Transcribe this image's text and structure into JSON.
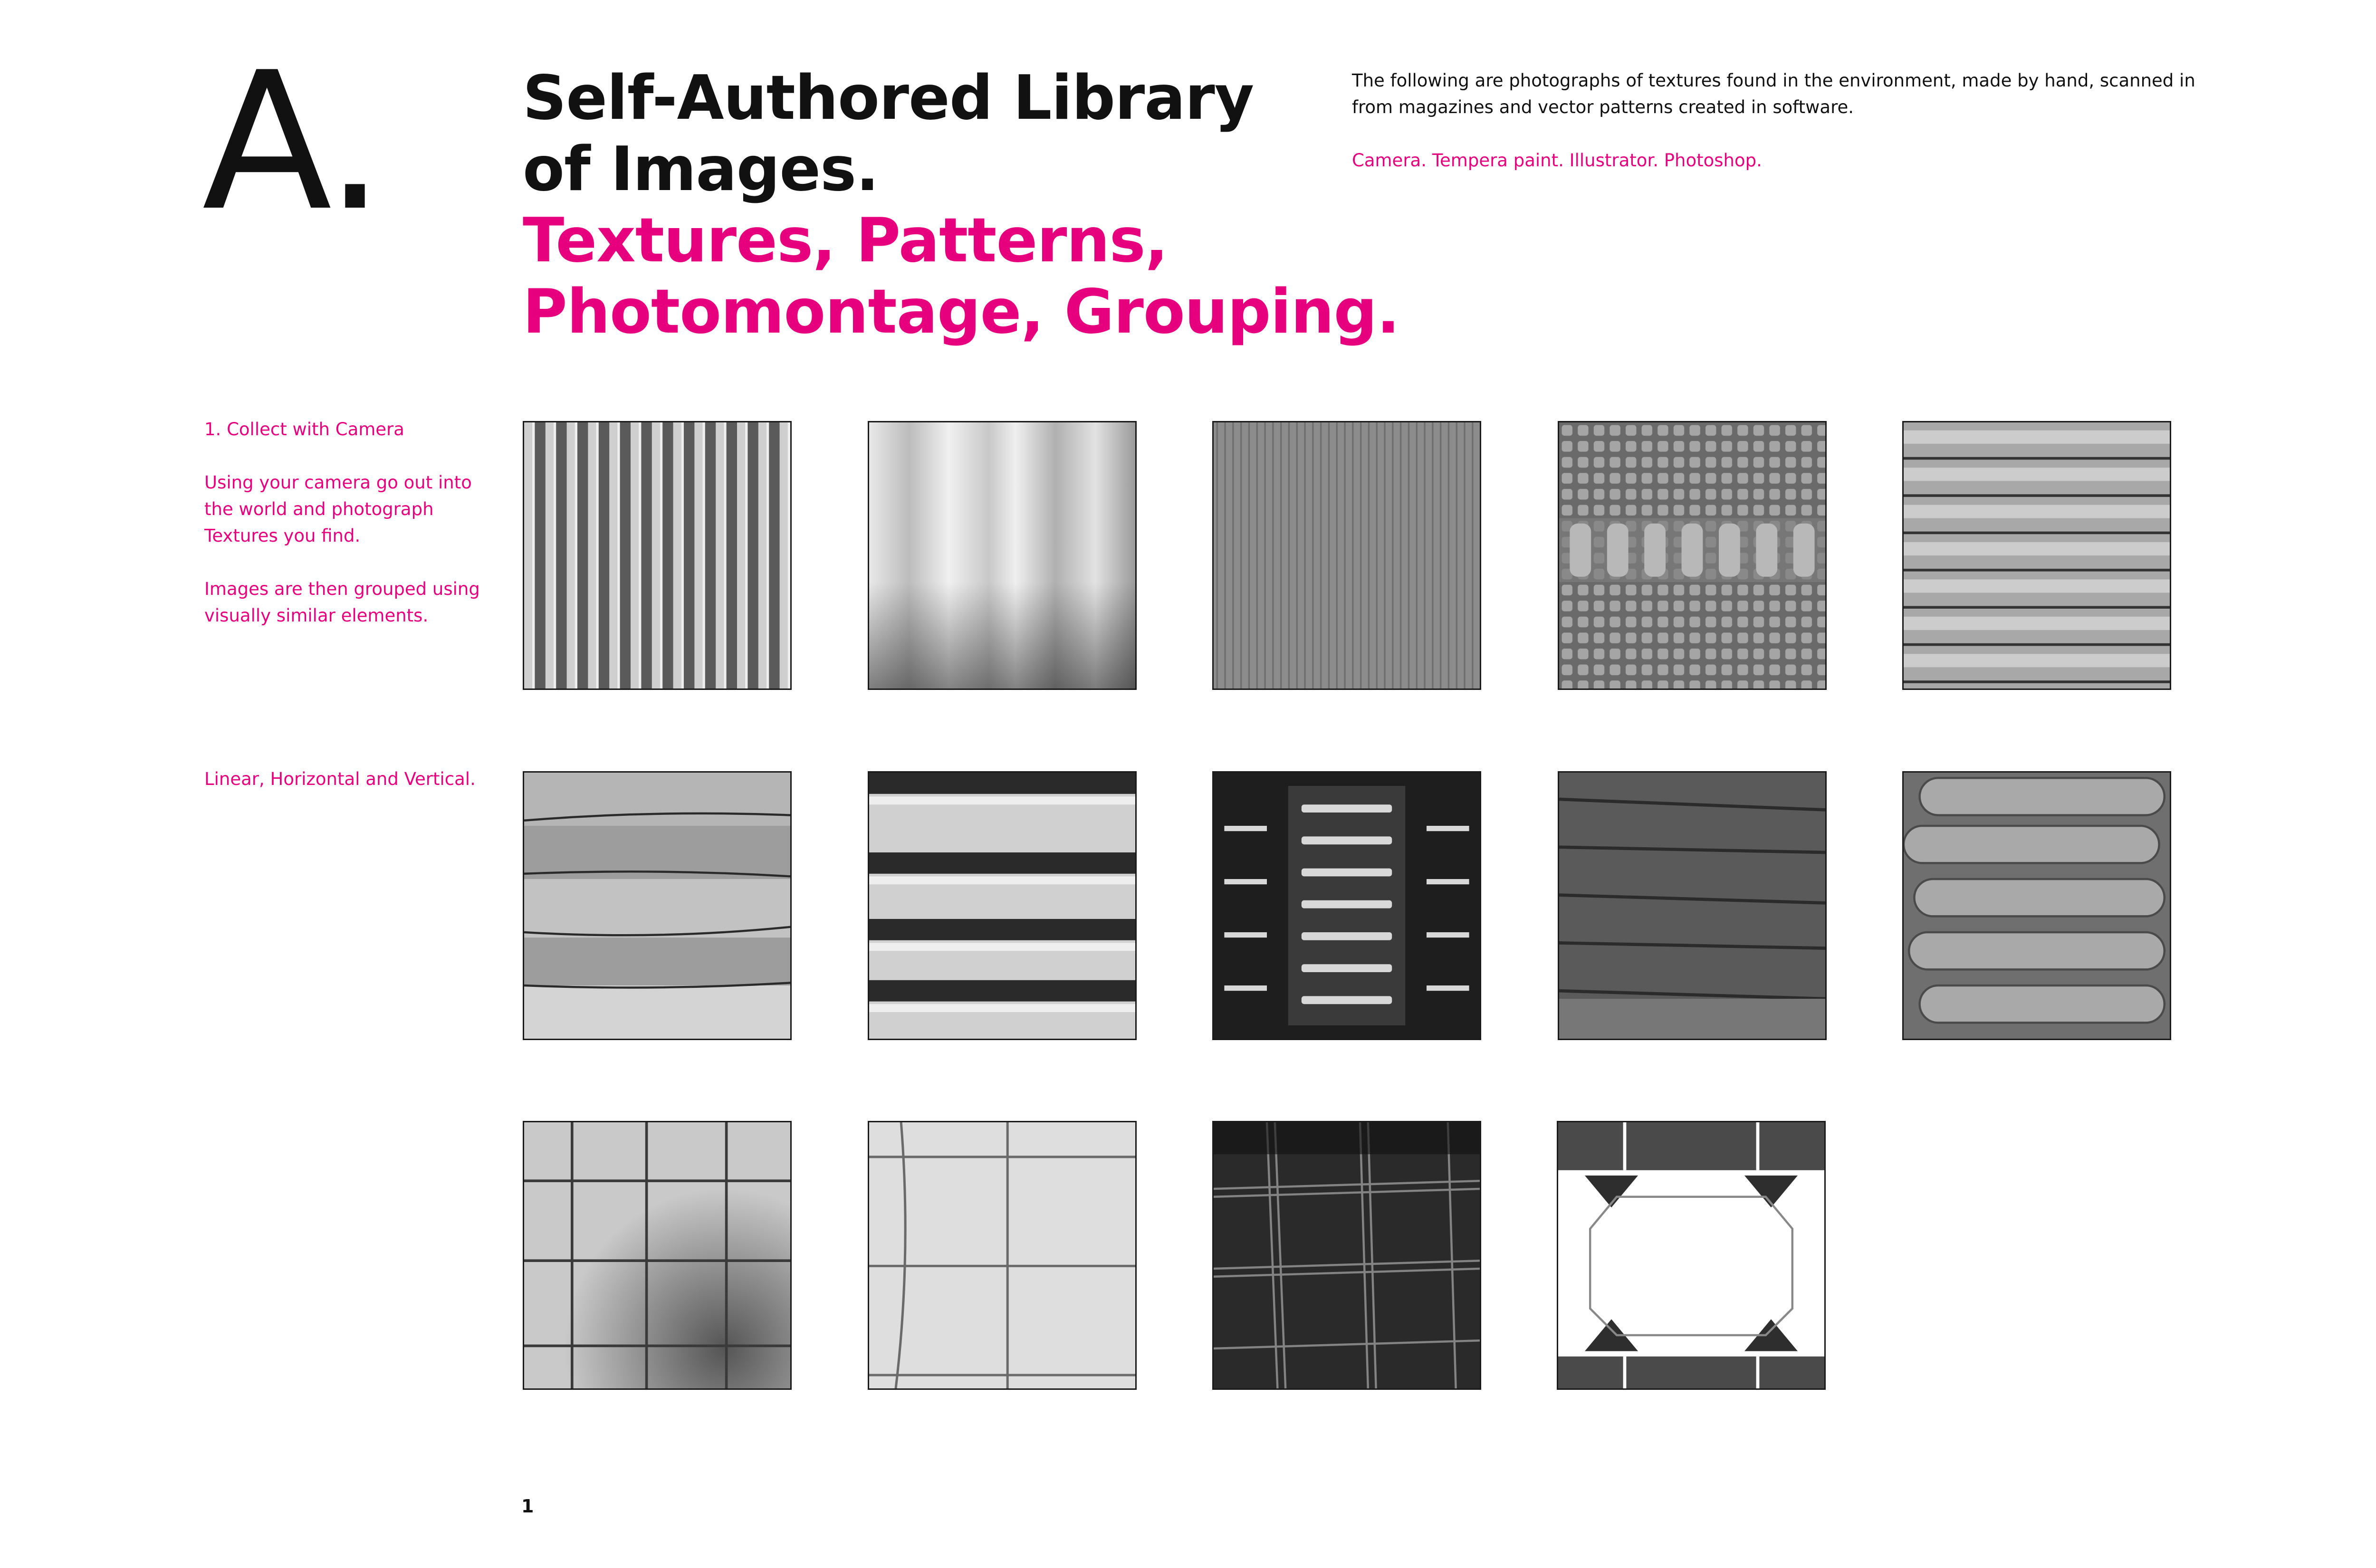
{
  "section": {
    "letter": "A."
  },
  "title": {
    "line1": "Self-Authored Library",
    "line2": "of Images.",
    "line3": "Textures, Patterns,",
    "line4": "Photomontage, Grouping."
  },
  "intro": {
    "text": "The following are photographs of textures found in the environment, made by hand, scanned in from magazines and vector patterns created in software.",
    "tools": "Camera. Tempera paint. Illustrator. Photoshop."
  },
  "sidebar": {
    "step": "1. Collect with Camera",
    "instructions": "Using your camera go out into the world and photograph Textures you find.",
    "grouping": "Images are then grouped using visually similar elements."
  },
  "group_label": "Linear, Horizontal and Vertical.",
  "page_number": "1",
  "colors": {
    "accent": "#e6007e",
    "text": "#111111",
    "background": "#ffffff"
  },
  "images": [
    {
      "name": "vertical-striped-fabric"
    },
    {
      "name": "soft-curtain-folds"
    },
    {
      "name": "wood-grain"
    },
    {
      "name": "woven-basket"
    },
    {
      "name": "horizontal-blinds"
    },
    {
      "name": "scratched-metal-bands"
    },
    {
      "name": "metal-slats"
    },
    {
      "name": "vent-grille"
    },
    {
      "name": "wet-concrete-lines"
    },
    {
      "name": "stacked-wavy-rolls"
    },
    {
      "name": "square-tiles"
    },
    {
      "name": "bathroom-tiles"
    },
    {
      "name": "plaid-fabric"
    },
    {
      "name": "octagon-floor-tile"
    }
  ]
}
